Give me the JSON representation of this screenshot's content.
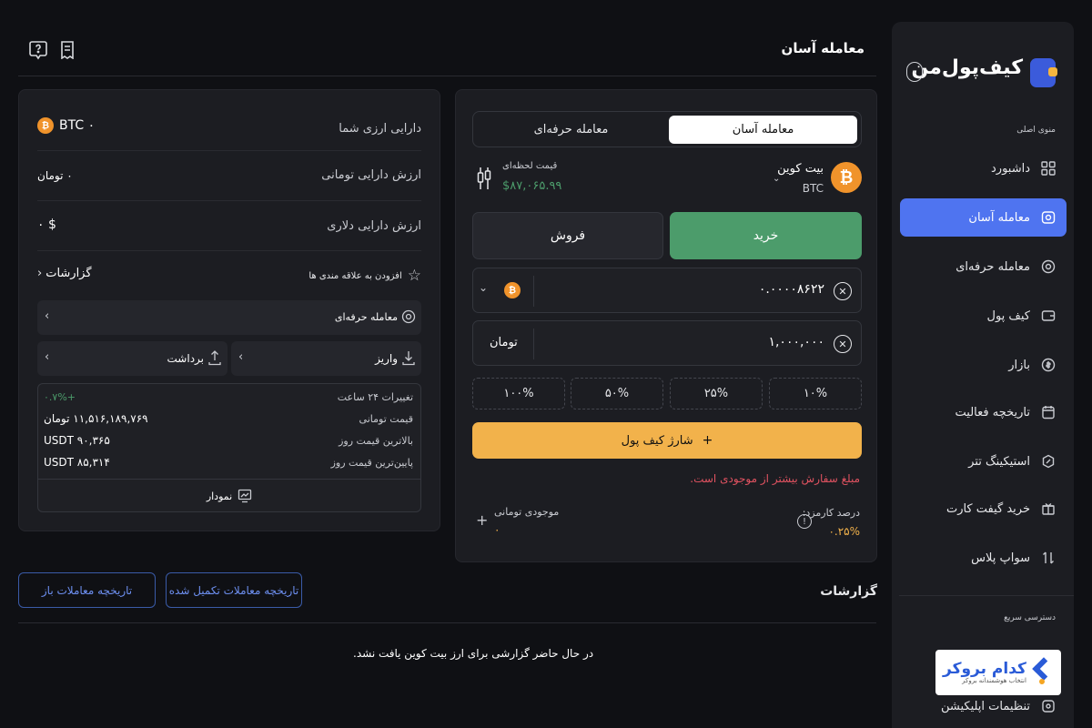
{
  "app": {
    "logo_text": "کیف‌پول‌من",
    "collapse_icon": "chevron-left-icon"
  },
  "sidebar": {
    "menu_label": "منوی اصلی",
    "items": [
      {
        "label": "داشبورد",
        "icon": "dashboard-icon",
        "active": false
      },
      {
        "label": "معامله آسان",
        "icon": "easy-trade-icon",
        "active": true
      },
      {
        "label": "معامله حرفه‌ای",
        "icon": "pro-trade-icon",
        "active": false
      },
      {
        "label": "کیف پول",
        "icon": "wallet-icon",
        "active": false
      },
      {
        "label": "بازار",
        "icon": "market-icon",
        "active": false
      },
      {
        "label": "تاریخچه فعالیت",
        "icon": "history-icon",
        "active": false
      },
      {
        "label": "استیکینگ تتر",
        "icon": "staking-icon",
        "active": false
      },
      {
        "label": "خرید گیفت کارت",
        "icon": "gift-card-icon",
        "active": false
      },
      {
        "label": "سواپ پلاس",
        "icon": "swap-icon",
        "active": false
      }
    ],
    "quick_access_label": "دسترسی سریع",
    "broker_ad": {
      "title": "کدام بروکر",
      "subtitle": "انتخاب هوشمندانه بروکر"
    },
    "app_settings_label": "تنظیمات اپلیکیشن"
  },
  "header": {
    "title": "معامله آسان"
  },
  "trade": {
    "tabs": {
      "easy": "معامله آسان",
      "pro": "معامله حرفه‌ای"
    },
    "coin": {
      "name": "بیت کوین",
      "symbol": "BTC"
    },
    "price_label": "قیمت لحظه‌ای",
    "price_value": "$۸۷,۰۶۵.۹۹",
    "buy_label": "خرید",
    "sell_label": "فروش",
    "crypto_amount": "۰.۰۰۰۰۸۶۲۲",
    "toman_amount": "۱,۰۰۰,۰۰۰",
    "toman_label": "تومان",
    "percents": [
      "۱۰%",
      "۲۵%",
      "۵۰%",
      "۱۰۰%"
    ],
    "charge_label": "شارژ کیف پول",
    "error_text": "مبلغ سفارش بیشتر از موجودی است.",
    "fee_label": "درصد کارمزد:",
    "fee_value": "۰.۲۵%",
    "balance_label": "موجودی تومانی",
    "balance_value": "۰"
  },
  "assets": {
    "crypto_label": "دارایی ارزی شما",
    "crypto_value": "۰ BTC",
    "toman_label": "ارزش دارایی تومانی",
    "toman_value": "۰ تومان",
    "dollar_label": "ارزش دارایی دلاری",
    "dollar_value": "$ ۰",
    "favorite_label": "افزودن به علاقه مندی ها",
    "reports_link": "گزارشات",
    "pro_trade_link": "معامله حرفه‌ای",
    "deposit_label": "واریز",
    "withdraw_label": "برداشت",
    "stats": [
      {
        "label": "تغییرات ۲۴ ساعت",
        "value": "+۰.۷%"
      },
      {
        "label": "قیمت تومانی",
        "value": "۱۱,۵۱۶,۱۸۹,۷۶۹ تومان"
      },
      {
        "label": "بالاترین قیمت روز",
        "value": "USDT ۹۰,۳۶۵"
      },
      {
        "label": "پایین‌ترین قیمت روز",
        "value": "USDT ۸۵,۳۱۴"
      }
    ],
    "chart_label": "نمودار",
    "positive_color": "#4c9c6b"
  },
  "reports": {
    "title": "گزارشات",
    "completed_btn": "تاریخچه معاملات تکمیل شده",
    "open_btn": "تاریخچه معاملات باز",
    "empty_text": "در حال حاضر گزارشی برای ارز بیت کوین یافت نشد."
  }
}
